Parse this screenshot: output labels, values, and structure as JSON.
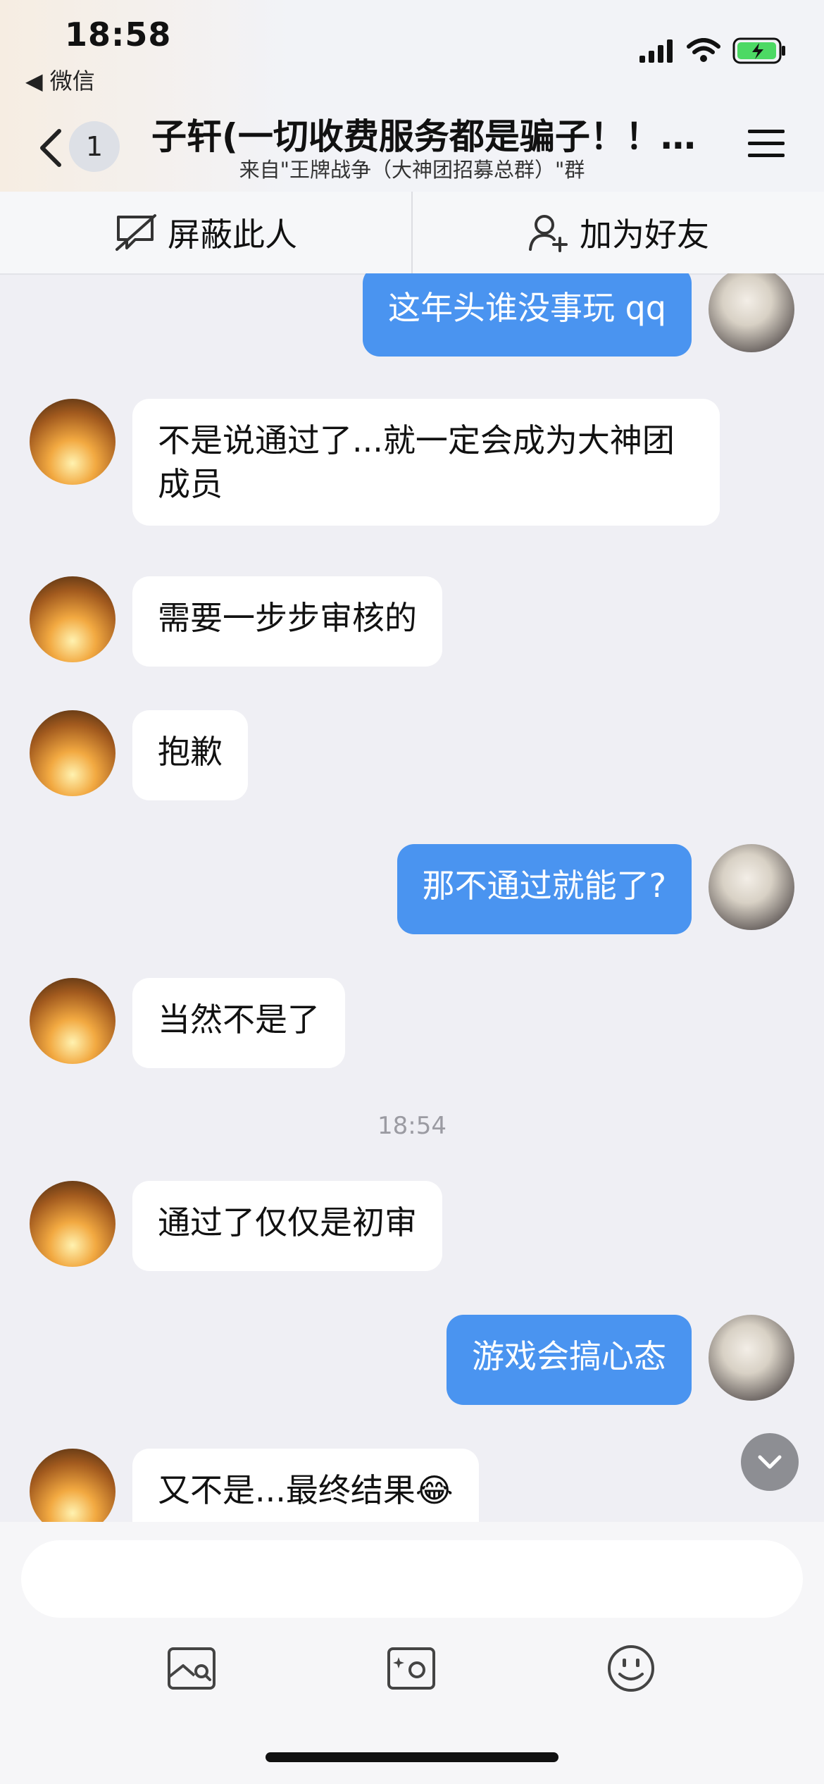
{
  "status_bar": {
    "time": "18:58",
    "back_app": "◀ 微信"
  },
  "header": {
    "unread_count": "1",
    "title": "子轩(一切收费服务都是骗子！！…",
    "subtitle": "来自\"王牌战争（大神团招募总群）\"群"
  },
  "actions": {
    "block_label": "屏蔽此人",
    "add_friend_label": "加为好友"
  },
  "messages": [
    {
      "from": "me",
      "text": "这年头谁没事玩 qq"
    },
    {
      "from": "other",
      "text": "不是说通过了...就一定会成为大神团成员"
    },
    {
      "from": "other",
      "text": "需要一步步审核的"
    },
    {
      "from": "other",
      "text": "抱歉"
    },
    {
      "from": "me",
      "text": "那不通过就能了?"
    },
    {
      "from": "other",
      "text": "当然不是了"
    },
    {
      "from": "other",
      "text": "通过了仅仅是初审"
    },
    {
      "from": "me",
      "text": "游戏会搞心态"
    },
    {
      "from": "other",
      "text": "又不是...最终结果😂"
    }
  ],
  "timestamp": "18:54",
  "composer": {
    "placeholder": ""
  },
  "colors": {
    "sent_bubble": "#4a94f0",
    "received_bubble": "#ffffff",
    "background": "#efeff4"
  }
}
